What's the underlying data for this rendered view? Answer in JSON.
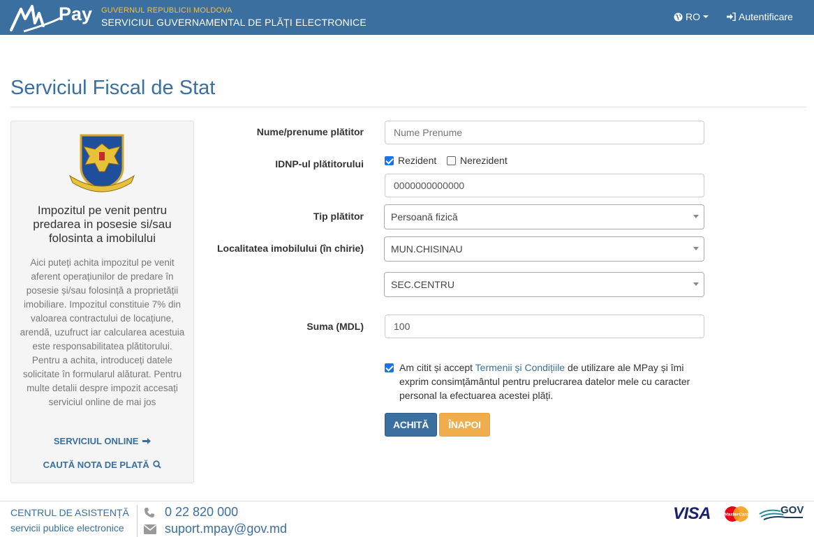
{
  "header": {
    "logo_text": "Pay",
    "gov_line1": "GUVERNUL REPUBLICII MOLDOVA",
    "gov_line2": "SERVICIUL GUVERNAMENTAL DE PLĂȚI ELECTRONICE",
    "language": "RO",
    "login": "Autentificare"
  },
  "page": {
    "title": "Serviciul Fiscal de Stat"
  },
  "panel": {
    "emblem_text": "SERVICIUL FISCAL DE STAT",
    "heading": "Impozitul pe venit pentru predarea in posesie si/sau folosinta a imobilului",
    "description": "Aici puteți achita impozitul pe venit aferent operațiunilor de predare în posesie și/sau folosință a proprietății imobiliare. Impozitul constituie 7% din valoarea contractului de locațiune, arendă, uzufruct iar calcularea acestuia este responsabilitatea plătitorului. Pentru a achita, introduceți datele solicitate în formularul alăturat. Pentru multe detalii despre impozit accesați serviciul online de mai jos",
    "link_online": "SERVICIUL ONLINE",
    "link_search": "CAUTĂ NOTA DE PLATĂ"
  },
  "form": {
    "payer_name_label": "Nume/prenume plătitor",
    "payer_name_placeholder": "Nume Prenume",
    "idnp_label": "IDNP-ul plătitorului",
    "resident_label": "Rezident",
    "resident_checked": true,
    "nonresident_label": "Nerezident",
    "nonresident_checked": false,
    "idnp_value": "0000000000000",
    "payer_type_label": "Tip plătitor",
    "payer_type_value": "Persoană fizică",
    "locality_label": "Localitatea imobilului (în chirie)",
    "locality_value": "MUN.CHISINAU",
    "sector_value": "SEC.CENTRU",
    "amount_label": "Suma (MDL)",
    "amount_value": "100",
    "terms_before": "Am citit și accept ",
    "terms_link": "Termenii și Condițiile",
    "terms_after": " de utilizare ale MPay și îmi exprim consimțământul pentru prelucrarea datelor mele cu caracter personal la efectuarea acestei plăți.",
    "terms_checked": true,
    "pay_button": "ACHITĂ",
    "back_button": "ÎNAPOI"
  },
  "footer": {
    "help_title": "CENTRUL DE ASISTENȚĂ",
    "help_subtitle": "servicii publice electronice",
    "phone": "0 22 820 000",
    "email": "suport.mpay@gov.md",
    "visa": "VISA",
    "mastercard": "MasterCard",
    "gov": "GOV"
  },
  "colors": {
    "brand_blue": "#3a6fa0",
    "accent_gold": "#f0c24a",
    "back_orange": "#f0ad4e"
  }
}
